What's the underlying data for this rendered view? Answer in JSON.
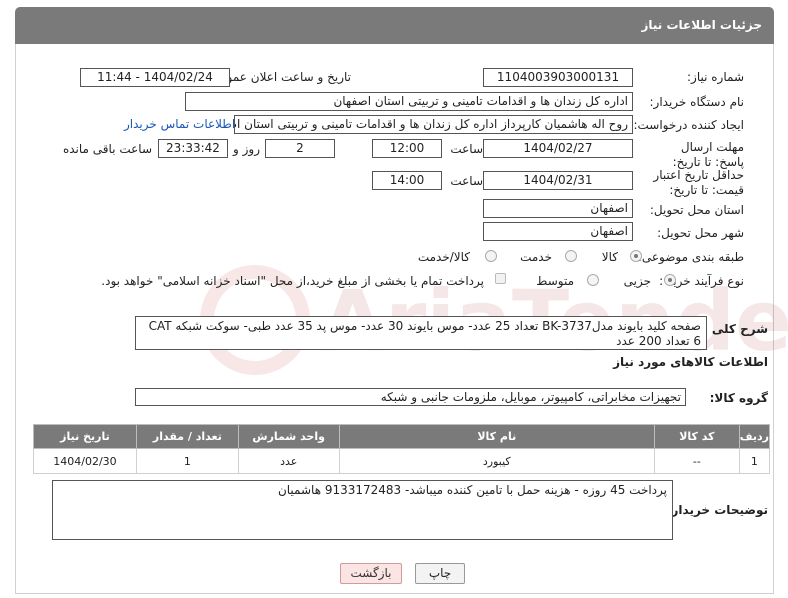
{
  "header": {
    "title": "جزئیات اطلاعات نیاز"
  },
  "fields": {
    "need_number_label": "شماره نیاز:",
    "need_number": "1104003903000131",
    "announce_label": "تاریخ و ساعت اعلان عمومی:",
    "announce_value": "1404/02/24 - 11:44",
    "buyer_org_label": "نام دستگاه خریدار:",
    "buyer_org": "اداره کل زندان ها و اقدامات تامینی و تربیتی استان اصفهان",
    "creator_label": "ایجاد کننده درخواست:",
    "creator": "روح اله هاشمیان کارپرداز اداره کل زندان ها و اقدامات تامینی و تربیتی استان اصفهان",
    "contact_link": "اطلاعات تماس خریدار",
    "reply_deadline_label": "مهلت ارسال پاسخ: تا تاریخ:",
    "reply_date": "1404/02/27",
    "time_label": "ساعت",
    "reply_time": "12:00",
    "days_value": "2",
    "days_label": "روز و",
    "remaining_time": "23:33:42",
    "remaining_label": "ساعت باقی مانده",
    "price_validity_label": "حداقل تاریخ اعتبار قیمت: تا تاریخ:",
    "price_date": "1404/02/31",
    "price_time": "14:00",
    "province_label": "استان محل تحویل:",
    "province": "اصفهان",
    "city_label": "شهر محل تحویل:",
    "city": "اصفهان",
    "category_label": "طبقه بندی موضوعی:",
    "category_options": [
      "کالا",
      "خدمت",
      "کالا/خدمت"
    ],
    "purchase_type_label": "نوع فرآیند خرید :",
    "purchase_options": [
      "جزیی",
      "متوسط"
    ],
    "treasury_note": "پرداخت تمام یا بخشی از مبلغ خرید،از محل \"اسناد خزانه اسلامی\" خواهد بود."
  },
  "description": {
    "label": "شرح کلی نیاز:",
    "text": "صفحه کلید بایوند مدلBK-3737  تعداد 25 عدد- موس بایوند 30 عدد- موس پد 35 عدد طبی- سوکت شبکه CAT 6 تعداد 200 عدد"
  },
  "goods_section": {
    "title": "اطلاعات کالاهای مورد نیاز"
  },
  "goods_group": {
    "label": "گروه کالا:",
    "value": "تجهیزات مخابراتی، کامپیوتر، موبایل، ملزومات جانبی و شبکه"
  },
  "table": {
    "headers": [
      "ردیف",
      "کد کالا",
      "نام کالا",
      "واحد شمارش",
      "تعداد / مقدار",
      "تاریخ نیاز"
    ],
    "rows": [
      [
        "1",
        "--",
        "کیبورد",
        "عدد",
        "1",
        "1404/02/30"
      ]
    ]
  },
  "buyer_notes": {
    "label": "توضیحات خریدار:",
    "text": "پرداخت 45 روزه - هزینه حمل با تامین کننده میباشد- 9133172483 هاشمیان"
  },
  "buttons": {
    "print": "چاپ",
    "back": "بازگشت"
  },
  "watermark": {
    "text": "AriaTender.neT"
  }
}
